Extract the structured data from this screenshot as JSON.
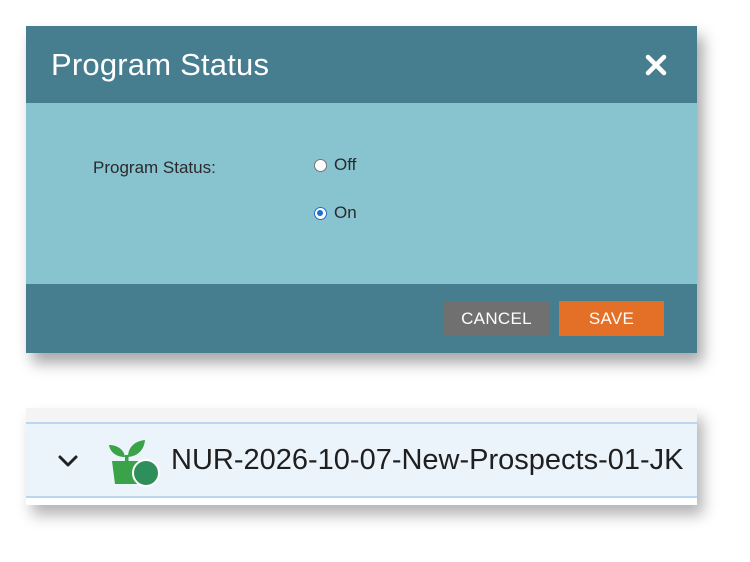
{
  "dialog": {
    "title": "Program Status",
    "field_label": "Program Status:",
    "options": [
      {
        "label": "Off",
        "selected": false
      },
      {
        "label": "On",
        "selected": true
      }
    ],
    "cancel_label": "CANCEL",
    "save_label": "SAVE"
  },
  "tree": {
    "program_name": "NUR-2026-10-07-New-Prospects-01-JK",
    "expanded": true
  },
  "colors": {
    "header": "#467d8f",
    "body": "#88c3d0",
    "cancel": "#707070",
    "save": "#e46f26",
    "icon_green": "#3aa34a"
  },
  "icons": [
    "close-icon",
    "chevron-down-icon",
    "program-icon"
  ]
}
